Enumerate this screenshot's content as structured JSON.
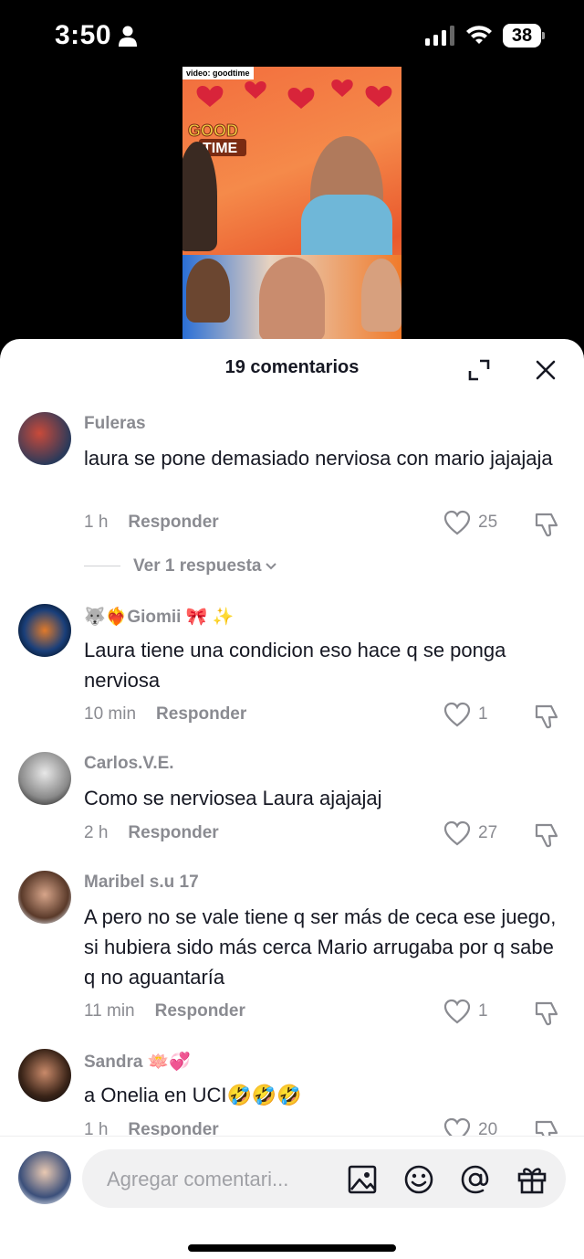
{
  "status_bar": {
    "time": "3:50",
    "battery": "38"
  },
  "video": {
    "tag": "video: goodtime",
    "logo_line1": "GOOD",
    "logo_line2": "TIME"
  },
  "header": {
    "title": "19 comentarios"
  },
  "comments": [
    {
      "username": "Fuleras",
      "text": "laura se pone demasiado nerviosa con mario jajajaja",
      "time": "1 h",
      "reply_label": "Responder",
      "likes": "25",
      "view_replies": "Ver 1 respuesta"
    },
    {
      "username": "🐺❤️‍🔥Giomii 🎀 ✨",
      "text": "Laura tiene una condicion eso hace q se ponga nerviosa",
      "time": "10 min",
      "reply_label": "Responder",
      "likes": "1"
    },
    {
      "username": "Carlos.V.E.",
      "text": "Como se nerviosea Laura ajajajaj",
      "time": "2 h",
      "reply_label": "Responder",
      "likes": "27"
    },
    {
      "username": "Maribel s.u 17",
      "text": "A pero no se vale tiene q ser más de ceca ese juego, si hubiera sido más cerca Mario arrugaba por q sabe q no aguantaría",
      "time": "11 min",
      "reply_label": "Responder",
      "likes": "1"
    },
    {
      "username": "Sandra 🪷💞",
      "text": "a Onelia en UCI🤣🤣🤣",
      "time": "1 h",
      "reply_label": "Responder",
      "likes": "20"
    }
  ],
  "input": {
    "placeholder": "Agregar comentari..."
  },
  "colors": {
    "text_primary": "#161823",
    "text_secondary": "#8a8b91",
    "input_bg": "#f1f1f2"
  },
  "icons": [
    "person-icon",
    "signal-icon",
    "wifi-icon",
    "expand-icon",
    "close-icon",
    "heart-icon",
    "dislike-icon",
    "image-icon",
    "emoji-icon",
    "mention-icon",
    "gift-icon"
  ]
}
